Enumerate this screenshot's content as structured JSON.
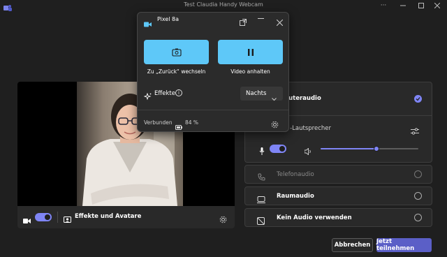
{
  "window": {
    "title": "Test Claudia Handy Webcam"
  },
  "video": {
    "effects_label": "Effekte und Avatare"
  },
  "audio": {
    "computer_audio_label": "Computeraudio",
    "computer_audio_visible_text": "puteraudio",
    "speaker_text": "d -Lautsprecher",
    "volume_level": 0.57,
    "options": [
      {
        "label": "Telefonaudio",
        "enabled": false
      },
      {
        "label": "Raumaudio",
        "enabled": true
      },
      {
        "label": "Kein Audio verwenden",
        "enabled": true
      }
    ]
  },
  "footer": {
    "cancel_label": "Abbrechen",
    "join_label": "Jetzt teilnehmen"
  },
  "popup": {
    "device_name": "Pixel 8a",
    "switch_label": "Zu „Zurück“ wechseln",
    "pause_label": "Video anhalten",
    "effects_label": "Effekte",
    "effect_selected": "Nachts",
    "status_label": "Verbunden",
    "battery_percent": "84 %"
  },
  "colors": {
    "accent": "#7f85f5",
    "popup_button": "#5ec8f8",
    "background": "#1f1f1f",
    "panel": "#292929"
  }
}
